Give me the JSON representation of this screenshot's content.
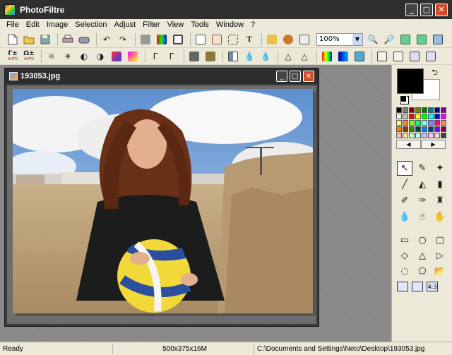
{
  "window": {
    "title": "PhotoFiltre",
    "minimize": "_",
    "maximize": "□",
    "close": "✕"
  },
  "menu": [
    "File",
    "Edit",
    "Image",
    "Selection",
    "Adjust",
    "Filter",
    "View",
    "Tools",
    "Window",
    "?"
  ],
  "toolbar1": {
    "buttons_a": [
      "new-file-icon",
      "open-folder-icon",
      "save-icon",
      "print-icon",
      "scan-icon"
    ],
    "buttons_b": [
      "undo-icon",
      "redo-icon"
    ],
    "buttons_c": [
      "image-size-icon",
      "color-depth-icon",
      "canvas-size-icon",
      "text-frame-icon",
      "auto-crop-icon",
      "selection-icon",
      "text-icon",
      "plugin-icon",
      "explorer-icon",
      "preview-window-icon"
    ],
    "zoom": "100%",
    "buttons_d": [
      "zoom-in-icon",
      "zoom-out-icon",
      "fit-window-icon",
      "actual-size-icon",
      "fullscreen-icon"
    ]
  },
  "toolbar2": {
    "labels": {
      "auto1": "AUTO",
      "auto2": "AUTO"
    },
    "buttons": [
      "auto-levels-icon",
      "auto-contrast-icon",
      "brightness-down-icon",
      "brightness-up-icon",
      "contrast-down-icon",
      "contrast-up-icon",
      "saturation-down-icon",
      "saturation-up-icon",
      "gamma-down-icon",
      "gamma-up-icon",
      "grayscale-icon",
      "sepia-icon",
      "mirror-icon",
      "blur-icon",
      "sharpen-icon",
      "soften-icon",
      "emboss-icon",
      "gradient-icon",
      "color-fill-icon",
      "negative-icon",
      "flip-horizontal-icon",
      "flip-vertical-icon",
      "rotate-left-icon",
      "rotate-right-icon"
    ]
  },
  "image_window": {
    "filename": "193053.jpg"
  },
  "palette_colors": [
    "#000000",
    "#808080",
    "#800000",
    "#808000",
    "#008000",
    "#008080",
    "#000080",
    "#800080",
    "#ffffff",
    "#c0c0c0",
    "#ff0000",
    "#ffff00",
    "#00ff00",
    "#00ffff",
    "#0000ff",
    "#ff00ff",
    "#ffff80",
    "#ff8040",
    "#80ff00",
    "#00ff80",
    "#80ffff",
    "#8080ff",
    "#ff0080",
    "#ff8080",
    "#ff8000",
    "#804000",
    "#408000",
    "#004040",
    "#0080ff",
    "#004080",
    "#8000ff",
    "#800040",
    "#ffc0c0",
    "#ffe0a0",
    "#c0ffc0",
    "#c0ffff",
    "#c0c0ff",
    "#ffc0ff",
    "#e0e0e0",
    "#404040"
  ],
  "palette_nav": {
    "prev": "◀",
    "next": "▶"
  },
  "tools": [
    "select-arrow-icon",
    "eyedropper-icon",
    "magic-wand-icon",
    "line-icon",
    "fill-bucket-icon",
    "spray-icon",
    "brush-icon",
    "smart-brush-icon",
    "stamp-icon",
    "blur-drop-icon",
    "smudge-icon",
    "hand-icon"
  ],
  "shapes": [
    "rectangle-icon",
    "ellipse-icon",
    "rounded-rect-icon",
    "diamond-icon",
    "triangle-icon",
    "arrow-right-icon",
    "lasso-icon",
    "polygon-icon",
    "open-file-icon"
  ],
  "modes": {
    "a": "",
    "b": "",
    "c": "4:3"
  },
  "status": {
    "state": "Ready",
    "dimensions": "500x375x16M",
    "path": "C:\\Documents and Settings\\Neto\\Desktop\\193053.jpg"
  }
}
